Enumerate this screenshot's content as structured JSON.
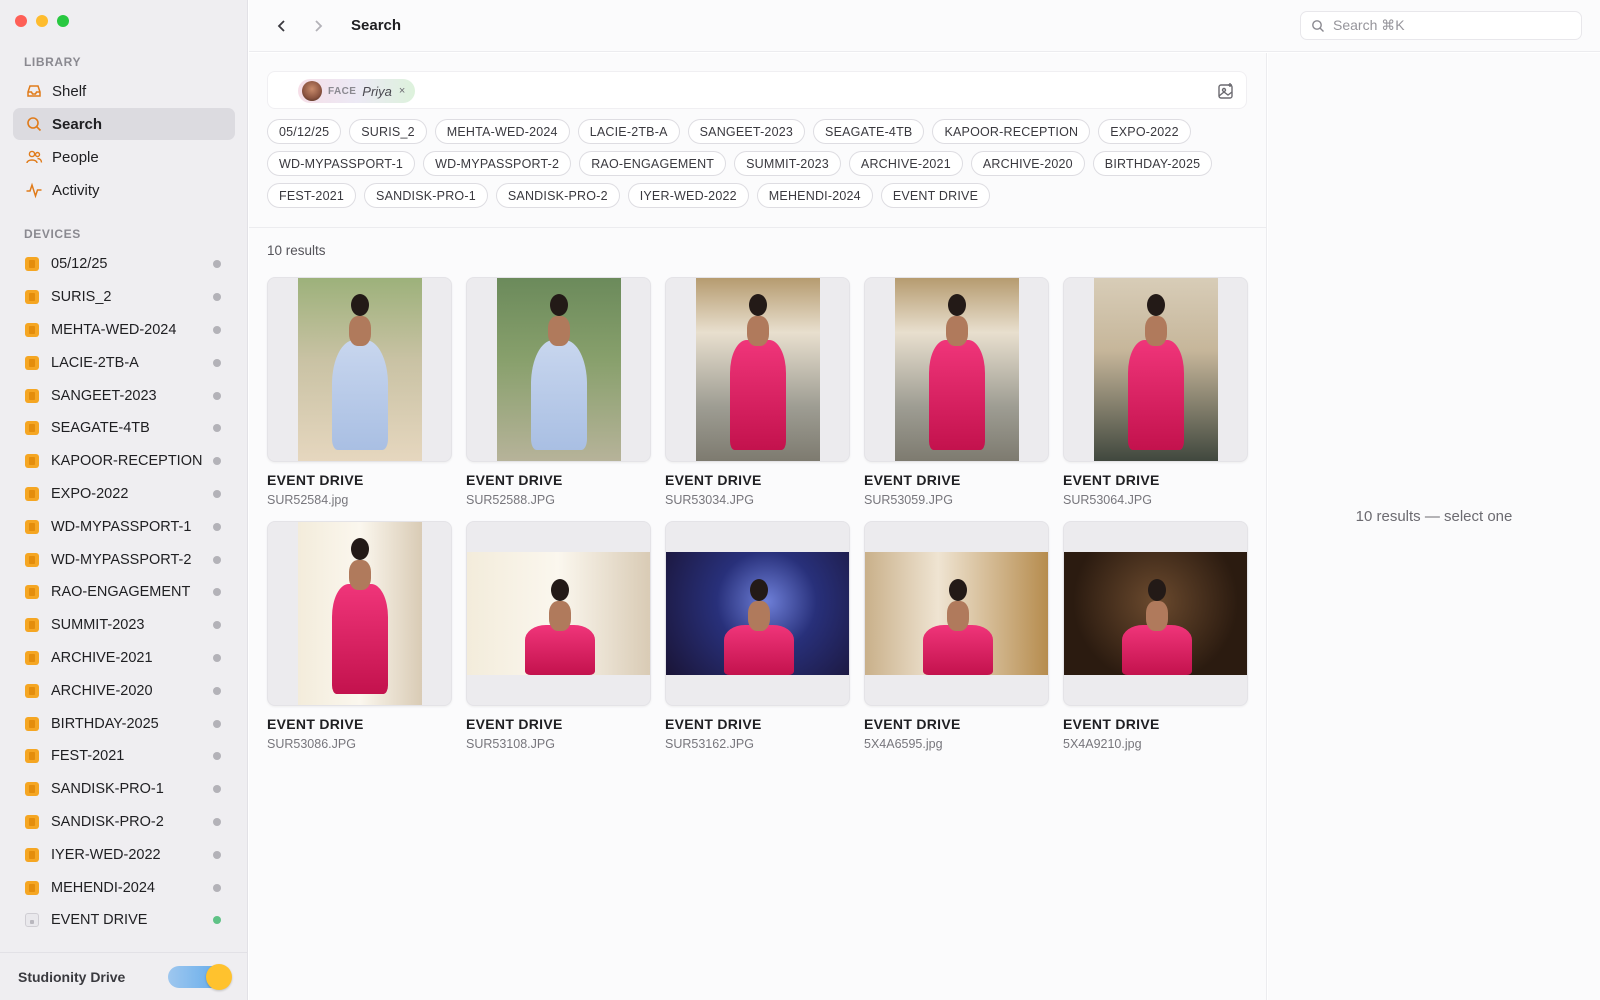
{
  "sidebar": {
    "library_label": "LIBRARY",
    "nav": [
      {
        "label": "Shelf",
        "icon": "tray-icon"
      },
      {
        "label": "Search",
        "icon": "search-icon",
        "active": true
      },
      {
        "label": "People",
        "icon": "people-icon"
      },
      {
        "label": "Activity",
        "icon": "activity-icon"
      }
    ],
    "devices_label": "DEVICES",
    "devices": [
      {
        "name": "05/12/25",
        "status": "offline"
      },
      {
        "name": "SURIS_2",
        "status": "offline"
      },
      {
        "name": "MEHTA-WED-2024",
        "status": "offline"
      },
      {
        "name": "LACIE-2TB-A",
        "status": "offline"
      },
      {
        "name": "SANGEET-2023",
        "status": "offline"
      },
      {
        "name": "SEAGATE-4TB",
        "status": "offline"
      },
      {
        "name": "KAPOOR-RECEPTION",
        "status": "offline"
      },
      {
        "name": "EXPO-2022",
        "status": "offline"
      },
      {
        "name": "WD-MYPASSPORT-1",
        "status": "offline"
      },
      {
        "name": "WD-MYPASSPORT-2",
        "status": "offline"
      },
      {
        "name": "RAO-ENGAGEMENT",
        "status": "offline"
      },
      {
        "name": "SUMMIT-2023",
        "status": "offline"
      },
      {
        "name": "ARCHIVE-2021",
        "status": "offline"
      },
      {
        "name": "ARCHIVE-2020",
        "status": "offline"
      },
      {
        "name": "BIRTHDAY-2025",
        "status": "offline"
      },
      {
        "name": "FEST-2021",
        "status": "offline"
      },
      {
        "name": "SANDISK-PRO-1",
        "status": "offline"
      },
      {
        "name": "SANDISK-PRO-2",
        "status": "offline"
      },
      {
        "name": "IYER-WED-2022",
        "status": "offline"
      },
      {
        "name": "MEHENDI-2024",
        "status": "offline"
      },
      {
        "name": "EVENT DRIVE",
        "status": "online"
      }
    ],
    "footer_label": "Studionity Drive",
    "footer_toggle_on": true
  },
  "topbar": {
    "title": "Search",
    "search_placeholder": "Search ⌘K"
  },
  "query": {
    "face_tag": "FACE",
    "face_name": "Priya",
    "remove_glyph": "×"
  },
  "filters": [
    "05/12/25",
    "SURIS_2",
    "MEHTA-WED-2024",
    "LACIE-2TB-A",
    "SANGEET-2023",
    "SEAGATE-4TB",
    "KAPOOR-RECEPTION",
    "EXPO-2022",
    "WD-MYPASSPORT-1",
    "WD-MYPASSPORT-2",
    "RAO-ENGAGEMENT",
    "SUMMIT-2023",
    "ARCHIVE-2021",
    "ARCHIVE-2020",
    "BIRTHDAY-2025",
    "FEST-2021",
    "SANDISK-PRO-1",
    "SANDISK-PRO-2",
    "IYER-WED-2022",
    "MEHENDI-2024",
    "EVENT DRIVE"
  ],
  "results": {
    "count_label": "10 results",
    "items": [
      {
        "drive": "EVENT DRIVE",
        "file": "SUR52584.jpg"
      },
      {
        "drive": "EVENT DRIVE",
        "file": "SUR52588.JPG"
      },
      {
        "drive": "EVENT DRIVE",
        "file": "SUR53034.JPG"
      },
      {
        "drive": "EVENT DRIVE",
        "file": "SUR53059.JPG"
      },
      {
        "drive": "EVENT DRIVE",
        "file": "SUR53064.JPG"
      },
      {
        "drive": "EVENT DRIVE",
        "file": "SUR53086.JPG"
      },
      {
        "drive": "EVENT DRIVE",
        "file": "SUR53108.JPG"
      },
      {
        "drive": "EVENT DRIVE",
        "file": "SUR53162.JPG"
      },
      {
        "drive": "EVENT DRIVE",
        "file": "5X4A6595.jpg"
      },
      {
        "drive": "EVENT DRIVE",
        "file": "5X4A9210.jpg"
      }
    ]
  },
  "detail": {
    "message": "10 results — select one"
  },
  "colors": {
    "accent": "#f5a623",
    "online": "#5fc286",
    "offline": "#b3b2b8",
    "toggle_knob": "#ffc22e"
  }
}
